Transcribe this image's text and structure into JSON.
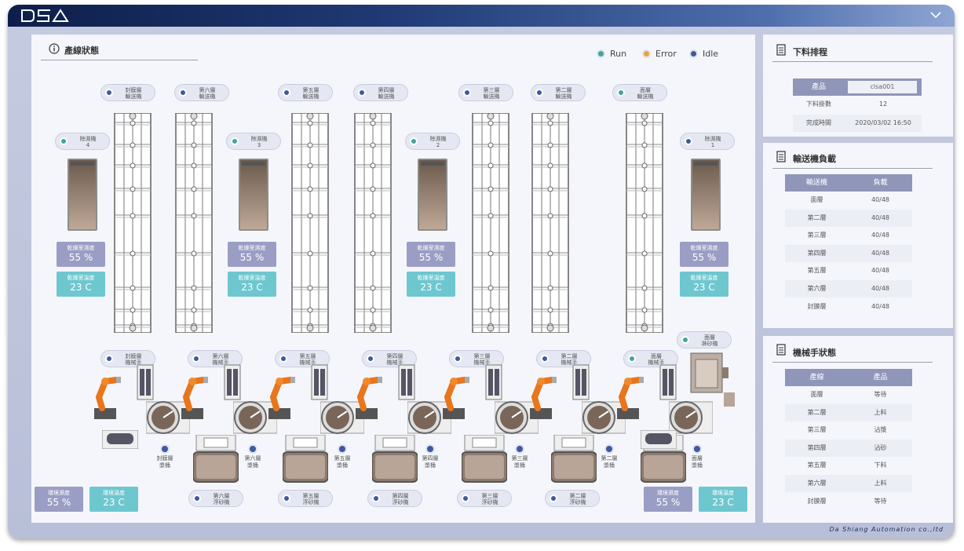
{
  "app": {
    "logo": "DSA",
    "brand": "Da Shiang Automation co.,ltd",
    "colors": {
      "run": "#43a59c",
      "error": "#f0a13c",
      "idle": "#3f58a0"
    }
  },
  "main": {
    "title": "產線狀態",
    "legend": [
      {
        "label": "Run",
        "status": "run"
      },
      {
        "label": "Error",
        "status": "error"
      },
      {
        "label": "Idle",
        "status": "idle"
      }
    ],
    "conveyors": [
      {
        "label": "封膜層\n輸送機",
        "status": "idle"
      },
      {
        "label": "第六層\n輸送機",
        "status": "idle"
      },
      {
        "label": "第五層\n輸送機",
        "status": "idle"
      },
      {
        "label": "第四層\n輸送機",
        "status": "idle"
      },
      {
        "label": "第三層\n輸送機",
        "status": "idle"
      },
      {
        "label": "第二層\n輸送機",
        "status": "idle"
      },
      {
        "label": "面層\n輸送機",
        "status": "run"
      }
    ],
    "dryers": [
      {
        "label": "除濕機\n4",
        "status": "run",
        "humidity_label": "乾燥室濕度",
        "humidity": "55 %",
        "temp_label": "乾燥室溫度",
        "temp": "23 C"
      },
      {
        "label": "除濕機\n3",
        "status": "run",
        "humidity_label": "乾燥室濕度",
        "humidity": "55 %",
        "temp_label": "乾燥室溫度",
        "temp": "23 C"
      },
      {
        "label": "除濕機\n2",
        "status": "run",
        "humidity_label": "乾燥室濕度",
        "humidity": "55 %",
        "temp_label": "乾燥室溫度",
        "temp": "23 C"
      },
      {
        "label": "除濕機\n1",
        "status": "idle",
        "humidity_label": "乾燥室濕度",
        "humidity": "55 %",
        "temp_label": "乾燥室溫度",
        "temp": "23 C"
      }
    ],
    "robots": [
      {
        "label": "封膜層\n機械手",
        "status": "idle"
      },
      {
        "label": "第六層\n機械手",
        "status": "idle"
      },
      {
        "label": "第五層\n機械手",
        "status": "idle"
      },
      {
        "label": "第四層\n機械手",
        "status": "idle"
      },
      {
        "label": "第三層\n機械手",
        "status": "idle"
      },
      {
        "label": "第二層\n機械手",
        "status": "idle"
      },
      {
        "label": "面層\n機械手",
        "status": "run"
      }
    ],
    "sander": {
      "label": "面層\n淋砂機",
      "status": "run"
    },
    "tanks": [
      {
        "label": "封膜層\n漿桶"
      },
      {
        "label": "第六層\n漿桶"
      },
      {
        "label": "第五層\n漿桶"
      },
      {
        "label": "第四層\n漿桶"
      },
      {
        "label": "第三層\n漿桶"
      },
      {
        "label": "第二層\n漿桶"
      },
      {
        "label": "面層\n漿桶"
      }
    ],
    "floaters": [
      {
        "label": "第六層\n浮砂機",
        "status": "idle"
      },
      {
        "label": "第五層\n浮砂機",
        "status": "idle"
      },
      {
        "label": "第四層\n浮砂機",
        "status": "idle"
      },
      {
        "label": "第三層\n浮砂機",
        "status": "idle"
      },
      {
        "label": "第二層\n浮砂機",
        "status": "idle"
      }
    ],
    "env_left": {
      "humidity_label": "環境濕度",
      "humidity": "55 %",
      "temp_label": "環境溫度",
      "temp": "23 C"
    },
    "env_right": {
      "humidity_label": "環境濕度",
      "humidity": "55 %",
      "temp_label": "環境溫度",
      "temp": "23 C"
    }
  },
  "schedule": {
    "title": "下料排程",
    "product_label": "產品",
    "product_value": "clsa001",
    "count_label": "下料掛數",
    "count_value": "12",
    "done_label": "完成時間",
    "done_value": "2020/03/02 16:50"
  },
  "load": {
    "title": "輸送機負載",
    "headers": [
      "輸送機",
      "負載"
    ],
    "rows": [
      [
        "面層",
        "40/48"
      ],
      [
        "第二層",
        "40/48"
      ],
      [
        "第三層",
        "40/48"
      ],
      [
        "第四層",
        "40/48"
      ],
      [
        "第五層",
        "40/48"
      ],
      [
        "第六層",
        "40/48"
      ],
      [
        "封膜層",
        "40/48"
      ]
    ]
  },
  "robot_status": {
    "title": "機械手狀態",
    "headers": [
      "產線",
      "產品"
    ],
    "rows": [
      [
        "面層",
        "等待"
      ],
      [
        "第二層",
        "上料"
      ],
      [
        "第三層",
        "沾漿"
      ],
      [
        "第四層",
        "沾砂"
      ],
      [
        "第五層",
        "下料"
      ],
      [
        "第六層",
        "上料"
      ],
      [
        "封膜層",
        "等待"
      ]
    ]
  }
}
